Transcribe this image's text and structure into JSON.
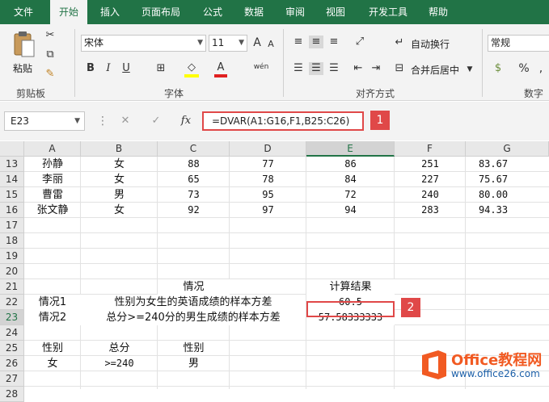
{
  "menu_tabs": [
    "文件",
    "开始",
    "插入",
    "页面布局",
    "公式",
    "数据",
    "审阅",
    "视图",
    "开发工具",
    "帮助"
  ],
  "ribbon": {
    "paste_label": "粘贴",
    "clipboard_label": "剪贴板",
    "font_name": "宋体",
    "font_size": "11",
    "font_group_label": "字体",
    "bold": "B",
    "italic": "I",
    "underline": "U",
    "grow_font": "A",
    "shrink_font": "A",
    "font_color_glyph": "A",
    "phonetic_glyph": "wén",
    "wrap_text": "自动换行",
    "merge_center": "合并后居中",
    "align_group_label": "对齐方式",
    "number_format": "常规",
    "percent": "%",
    "comma": ",",
    "number_group_label": "数字"
  },
  "formula_bar": {
    "name_box": "E23",
    "formula": "=DVAR(A1:G16,F1,B25:C26)",
    "badge1": "1",
    "badge2": "2",
    "cancel": "✕",
    "enter": "✓",
    "fx": "fx"
  },
  "columns": [
    "A",
    "B",
    "C",
    "D",
    "E",
    "F",
    "G"
  ],
  "rows": [
    "13",
    "14",
    "15",
    "16",
    "17",
    "18",
    "19",
    "20",
    "21",
    "22",
    "23",
    "24",
    "25",
    "26",
    "27",
    "28"
  ],
  "data_rows": [
    [
      "孙静",
      "女",
      "88",
      "77",
      "86",
      "251",
      "83.67"
    ],
    [
      "李丽",
      "女",
      "65",
      "78",
      "84",
      "227",
      "75.67"
    ],
    [
      "曹雷",
      "男",
      "73",
      "95",
      "72",
      "240",
      "80.00"
    ],
    [
      "张文静",
      "女",
      "92",
      "97",
      "94",
      "283",
      "94.33"
    ]
  ],
  "summary": {
    "situation_header": "情况",
    "result_header": "计算结果",
    "case1_label": "情况1",
    "case1_desc": "性别为女生的英语成绩的样本方差",
    "case1_value": "60.5",
    "case2_label": "情况2",
    "case2_desc": "总分>=240分的男生成绩的样本方差",
    "case2_value": "57.58333333"
  },
  "criteria": {
    "gender_header": "性别",
    "total_header": "总分",
    "gender_header2": "性别",
    "gender_value": "女",
    "total_value": ">=240",
    "gender_value2": "男"
  },
  "watermark": {
    "brand": "Office教程网",
    "url": "www.office26.com"
  },
  "colors": {
    "excel_green": "#217346",
    "highlight_red": "#e04848",
    "logo_orange": "#f15a22",
    "logo_blue": "#1b5fa8"
  }
}
